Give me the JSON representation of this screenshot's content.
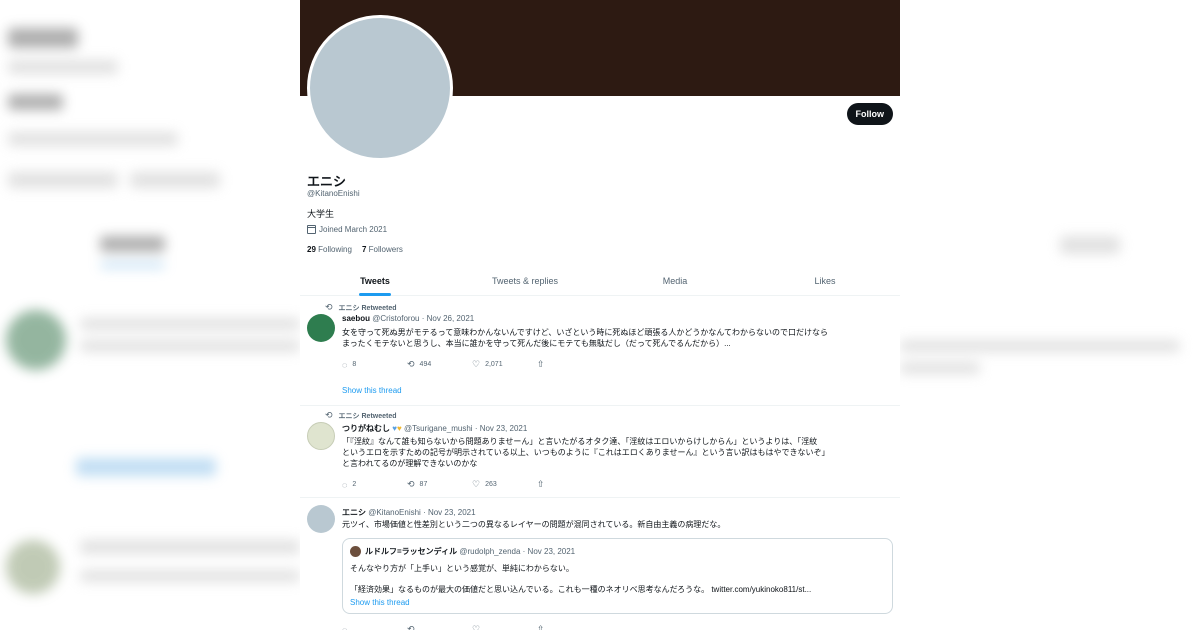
{
  "profile": {
    "display_name": "エニシ",
    "handle": "@KitanoEnishi",
    "bio": "大学生",
    "joined": "Joined March 2021",
    "following_count": "29",
    "following_label": "Following",
    "followers_count": "7",
    "followers_label": "Followers",
    "follow_button": "Follow"
  },
  "tabs": [
    {
      "label": "Tweets",
      "active": true
    },
    {
      "label": "Tweets & replies",
      "active": false
    },
    {
      "label": "Media",
      "active": false
    },
    {
      "label": "Likes",
      "active": false
    }
  ],
  "tweets": [
    {
      "retweeted_by": "エニシ Retweeted",
      "author": "saebou",
      "handle": "@Cristoforou",
      "date": "· Nov 26, 2021",
      "line1": "女を守って死ぬ男がモテるって意味わかんないんですけど、いざという時に死ぬほど頑張る人かどうかなんてわからないので口だけなら",
      "line2": "まったくモテないと思うし、本当に誰かを守って死んだ後にモテても無駄だし（だって死んでるんだから）...",
      "replies": "8",
      "retweets": "494",
      "likes": "2,071",
      "show_thread": "Show this thread"
    },
    {
      "retweeted_by": "エニシ Retweeted",
      "author": "つりがねむし",
      "handle": "@Tsurigane_mushi",
      "date": "· Nov 23, 2021",
      "line1": "「『淫紋』なんて誰も知らないから問題ありませーん」と言いたがるオタク達、「淫紋はエロいからけしからん」というよりは、「淫紋",
      "line2": "というエロを示すための記号が明示されている以上、いつものように『これはエロくありませーん』という言い訳はもはやできないぞ」",
      "line3": "と言われてるのが理解できないのかな",
      "replies": "2",
      "retweets": "87",
      "likes": "263"
    },
    {
      "author": "エニシ",
      "handle": "@KitanoEnishi",
      "date": "· Nov 23, 2021",
      "line1": "元ツイ、市場価値と性差別という二つの異なるレイヤーの問題が混同されている。新自由主義の病理だな。",
      "quote": {
        "author": "ルドルフ=ラッセンディル",
        "handle": "@rudolph_zenda",
        "date": "· Nov 23, 2021",
        "line1": "そんなやり方が「上手い」という感覚が、単純にわからない。",
        "line2": "「経済効果」なるものが最大の価値だと思い込んでいる。これも一種のネオリベ思考なんだろうな。 twitter.com/yukinoko811/st...",
        "show_thread": "Show this thread"
      }
    }
  ],
  "colors": {
    "banner": "#2d1a12",
    "avatar_placeholder": "#b9c8d1",
    "accent": "#1d9bf0",
    "follow_bg": "#0f1419"
  },
  "icons": [
    "reply-icon",
    "retweet-icon",
    "like-icon",
    "share-icon",
    "calendar-icon"
  ]
}
